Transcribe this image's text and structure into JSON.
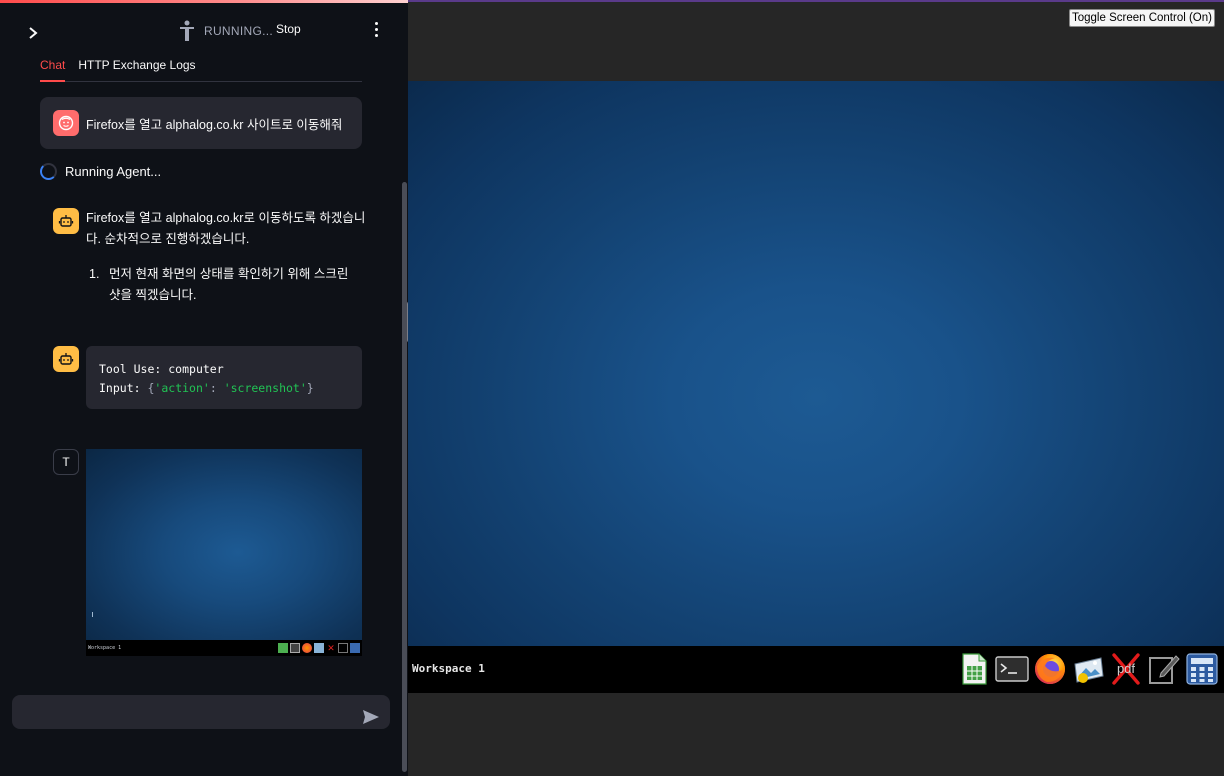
{
  "left_panel": {
    "status_text": "RUNNING...",
    "stop_label": "Stop",
    "tabs": [
      {
        "label": "Chat",
        "active": true
      },
      {
        "label": "HTTP Exchange Logs",
        "active": false
      }
    ],
    "user_message": "Firefox를 열고 alphalog.co.kr 사이트로 이동해줘",
    "running_text": "Running Agent...",
    "assistant_message": {
      "text": "Firefox를 열고 alphalog.co.kr로 이동하도록 하겠습니다. 순차적으로 진행하겠습니다.",
      "list_number": "1.",
      "list_item": "먼저 현재 화면의 상태를 확인하기 위해 스크린샷을 찍겠습니다."
    },
    "tool_use": {
      "line1_key": "Tool Use:",
      "line1_value": "computer",
      "line2_key": "Input:",
      "line2_open": "{",
      "line2_key_str": "'action'",
      "line2_colon": ":",
      "line2_val_str": "'screenshot'",
      "line2_close": "}"
    },
    "tool_result_avatar": "T",
    "thumbnail_workspace": "Workspace 1",
    "chat_input_placeholder": ""
  },
  "right_panel": {
    "toggle_label": "Toggle Screen Control (On)",
    "workspace_label": "Workspace 1",
    "tray_icons": [
      "spreadsheet-icon",
      "terminal-icon",
      "firefox-icon",
      "image-viewer-icon",
      "pdf-icon",
      "text-editor-icon",
      "calculator-icon"
    ]
  },
  "colors": {
    "accent": "#ff4b4b",
    "user_avatar": "#ff6c6c",
    "bot_avatar": "#ffbd45",
    "code_string": "#21c354",
    "sidebar_bg": "#0e1117",
    "desktop_blue": "#1d5a93"
  }
}
